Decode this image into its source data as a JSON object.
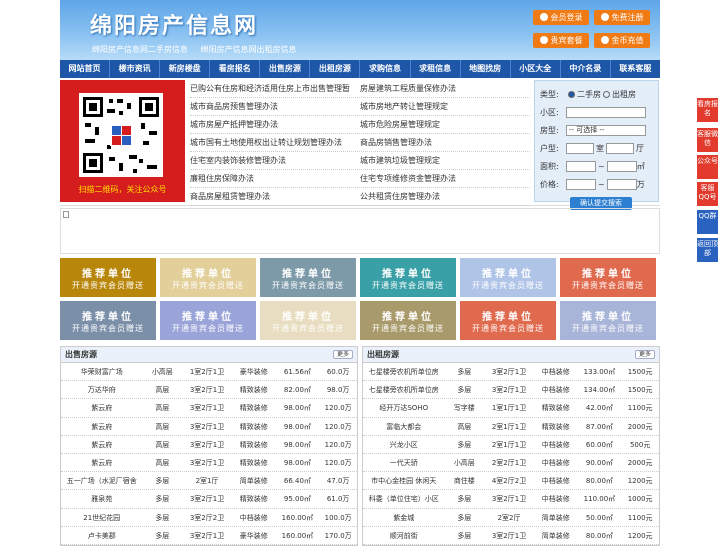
{
  "header": {
    "title": "绵阳房产信息网",
    "sublinks": [
      "绵阳房产信息网二手房信息",
      "绵阳房产信息网出租房信息"
    ],
    "buttons": [
      "会员登录",
      "免费注册",
      "贵宾套餐",
      "金币充值"
    ]
  },
  "nav": [
    "网站首页",
    "楼市资讯",
    "新房楼盘",
    "看房报名",
    "出售房源",
    "出租房源",
    "求购信息",
    "求租信息",
    "地图找房",
    "小区大全",
    "中介名录",
    "联系客服"
  ],
  "qr": {
    "caption": "扫描二维码，关注公众号"
  },
  "news": [
    [
      "已购公有住房和经济适用住房上市出售管理暂",
      "房屋建筑工程质量保修办法"
    ],
    [
      "城市商品房预售管理办法",
      "城市房地产转让管理规定"
    ],
    [
      "城市房屋产抵押管理办法",
      "城市危险房屋管理规定"
    ],
    [
      "城市国有土地使用权出让转让规划管理办法",
      "商品房销售管理办法"
    ],
    [
      "住宅室内装饰装修管理办法",
      "城市建筑垃圾管理规定"
    ],
    [
      "廉租住房保障办法",
      "住宅专项维修资金管理办法"
    ],
    [
      "商品房屋租赁管理办法",
      "公共租赁住房管理办法"
    ]
  ],
  "search": {
    "type_label": "类型:",
    "opt1": "二手房",
    "opt2": "出租房",
    "area_label": "小区:",
    "ptype_label": "房型:",
    "ptype_value": "-- 可选择 --",
    "huxing_label": "户型:",
    "shi": "室",
    "ting": "厅",
    "mianji_label": "面积:",
    "jiage_label": "价格:",
    "unit_area": "㎡",
    "unit_price": "万",
    "submit": "确认提交搜索"
  },
  "promo": {
    "t1": "推荐单位",
    "t2": "开通贵宾会员赠送",
    "colors": [
      "#b8860b",
      "#e2cf9a",
      "#7d9aa8",
      "#3aa0a8",
      "#b0c4e8",
      "#e06a4e",
      "#7b8fa8",
      "#9aa4d8",
      "#e8ddc0",
      "#a89a6a",
      "#e06a4e",
      "#a8b4d8"
    ]
  },
  "sale": {
    "title": "出售房源",
    "more": "更多",
    "rows": [
      [
        "华荣财富广场",
        "小高层",
        "1室2厅1卫",
        "豪华装修",
        "61.56㎡",
        "60.0万"
      ],
      [
        "万达华府",
        "高层",
        "3室2厅1卫",
        "精致装修",
        "82.00㎡",
        "98.0万"
      ],
      [
        "紫云府",
        "高层",
        "3室2厅1卫",
        "精致装修",
        "98.00㎡",
        "120.0万"
      ],
      [
        "紫云府",
        "高层",
        "3室2厅1卫",
        "精致装修",
        "98.00㎡",
        "120.0万"
      ],
      [
        "紫云府",
        "高层",
        "3室2厅1卫",
        "精致装修",
        "98.00㎡",
        "120.0万"
      ],
      [
        "紫云府",
        "高层",
        "3室2厅1卫",
        "精致装修",
        "98.00㎡",
        "120.0万"
      ],
      [
        "五一广场（水泥厂宿舍",
        "多层",
        "2室1厅",
        "简单装修",
        "66.40㎡",
        "47.0万"
      ],
      [
        "雅泉苑",
        "多层",
        "3室2厅1卫",
        "精致装修",
        "95.00㎡",
        "61.0万"
      ],
      [
        "21世纪花园",
        "多层",
        "3室2厅2卫",
        "中档装修",
        "160.00㎡",
        "100.0万"
      ],
      [
        "卢卡美郡",
        "多层",
        "3室2厅1卫",
        "豪华装修",
        "160.00㎡",
        "170.0万"
      ]
    ]
  },
  "rent": {
    "title": "出租房源",
    "more": "更多",
    "rows": [
      [
        "七星楼旁农机所单位房",
        "多层",
        "3室2厅1卫",
        "中档装修",
        "133.00㎡",
        "1500元"
      ],
      [
        "七星楼旁农机所单位房",
        "多层",
        "3室2厅1卫",
        "中档装修",
        "134.00㎡",
        "1500元"
      ],
      [
        "经开万达SOHO",
        "写字楼",
        "1室1厅1卫",
        "精致装修",
        "42.00㎡",
        "1100元"
      ],
      [
        "富临大都会",
        "高层",
        "2室1厅1卫",
        "精致装修",
        "87.00㎡",
        "2000元"
      ],
      [
        "兴龙小区",
        "多层",
        "2室1厅1卫",
        "中档装修",
        "60.00㎡",
        "500元"
      ],
      [
        "一代天骄",
        "小高层",
        "2室2厅1卫",
        "中档装修",
        "90.00㎡",
        "2000元"
      ],
      [
        "市中心金桂园 休闲天",
        "商住楼",
        "4室2厅2卫",
        "中档装修",
        "80.00㎡",
        "1200元"
      ],
      [
        "科委（单位住宅）小区",
        "多层",
        "3室2厅1卫",
        "中档装修",
        "110.00㎡",
        "1000元"
      ],
      [
        "紫金城",
        "多层",
        "2室2厅",
        "简单装修",
        "50.00㎡",
        "1100元"
      ],
      [
        "顺河前街",
        "多层",
        "3室2厅1卫",
        "简单装修",
        "80.00㎡",
        "1200元"
      ]
    ]
  },
  "side": [
    "看房报名",
    "客服微信",
    "公众号",
    "客服QQ号",
    "QQ群",
    "返回顶部"
  ]
}
